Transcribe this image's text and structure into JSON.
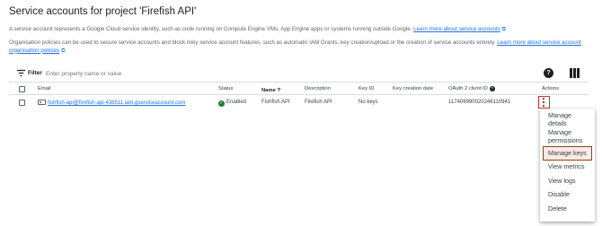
{
  "page": {
    "title": "Service accounts for project 'Firefish API'",
    "description_1": "A service account represents a Google Cloud service identity, such as code running on Compute Engine VMs, App Engine apps or systems running outside Google.",
    "description_1_link": "Learn more about service accounts",
    "description_2": "Organisation policies can be used to secure service accounts and block risky service account features, such as automatic IAM Grants, key creation/upload or the creation of service accounts entirely.",
    "description_2_link": "Learn more about service account organisation policies"
  },
  "filter": {
    "label": "Filter",
    "placeholder": "Enter property name or value"
  },
  "table": {
    "columns": {
      "email": "Email",
      "status": "Status",
      "name": "Name",
      "description": "Description",
      "key_id": "Key ID",
      "key_creation_date": "Key creation date",
      "oauth_client_id": "OAuth 2 client ID",
      "actions": "Actions"
    },
    "rows": [
      {
        "email": "fishfish-api@firefish-api-438511.iam.gserviceaccount.com",
        "status": "Enabled",
        "name": "Fishfish API",
        "description": "Firefish API",
        "key_id": "No keys",
        "key_creation_date": "",
        "oauth_client_id": "117409990020246110941"
      }
    ]
  },
  "actions_menu": {
    "items": [
      "Manage details",
      "Manage permissions",
      "Manage keys",
      "View metrics",
      "View logs",
      "Disable",
      "Delete"
    ]
  },
  "colors": {
    "link": "#1a73e8",
    "highlight_red": "#d93025",
    "highlight_brown": "#8b4513",
    "status_green": "#188038"
  }
}
